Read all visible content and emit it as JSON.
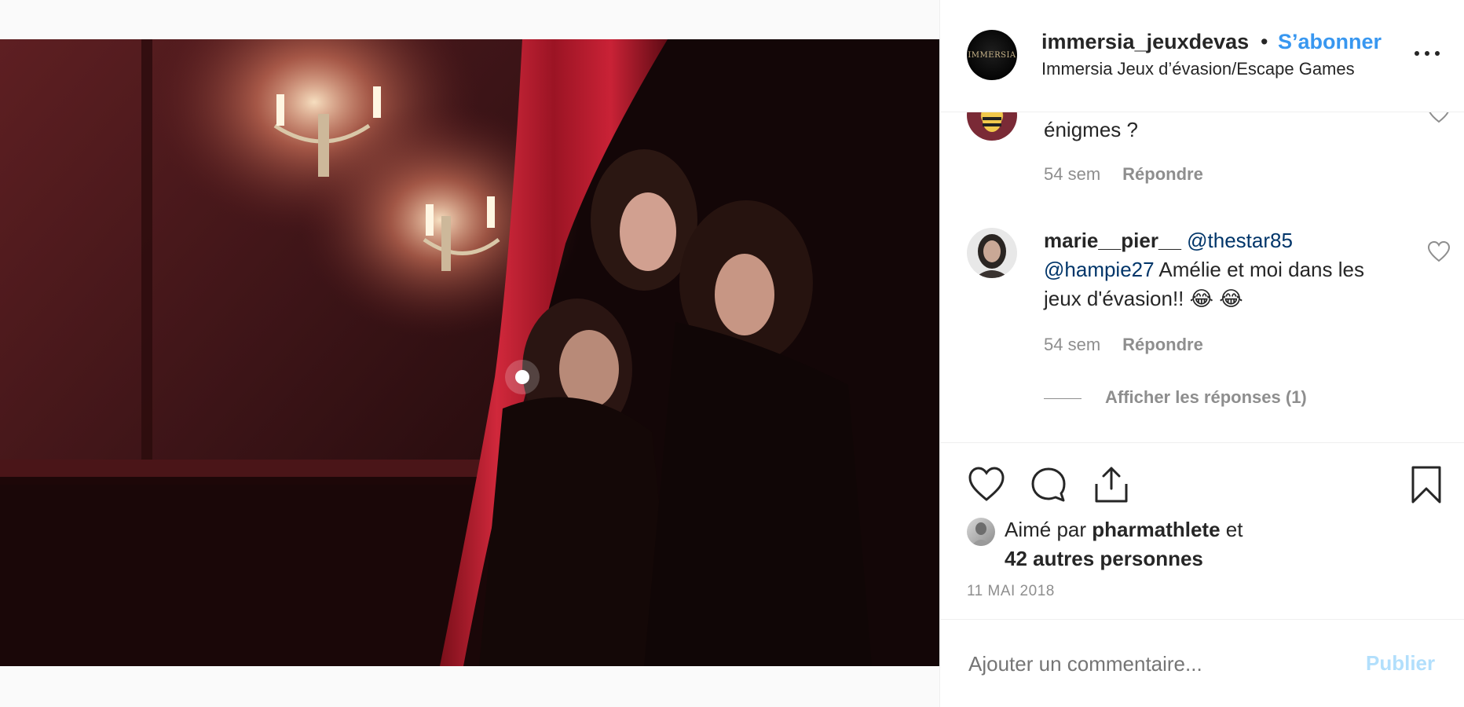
{
  "header": {
    "avatar_logo_text": "IMMERSIA",
    "username": "immersia_jeuxdevas",
    "separator": "•",
    "follow_label": "S’abonner",
    "subtitle": "Immersia Jeux d’évasion/Escape Games"
  },
  "comments": [
    {
      "text_tail": "énigmes ?",
      "time": "54 sem",
      "reply_label": "Répondre"
    },
    {
      "user": "marie__pier__",
      "mention1": "@thestar85",
      "mention2": "@hampie27",
      "text": "Amélie et moi dans les jeux d'évasion!!",
      "emoji": "😂 😂",
      "time": "54 sem",
      "reply_label": "Répondre",
      "view_replies": "Afficher les réponses (1)"
    }
  ],
  "likes": {
    "prefix": "Aimé par",
    "user": "pharmathlete",
    "conj": "et",
    "others": "42 autres personnes"
  },
  "date": "11 MAI 2018",
  "add_comment": {
    "placeholder": "Ajouter un commentaire...",
    "publish_label": "Publier"
  },
  "colors": {
    "accent": "#3897f0",
    "mention": "#003569",
    "muted": "#8e8e8e",
    "publish_disabled": "#b2dffc"
  }
}
